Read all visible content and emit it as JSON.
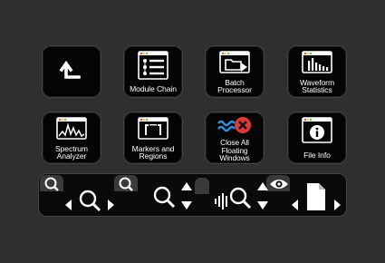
{
  "tiles": [
    {
      "id": "up",
      "label": "",
      "icon": "return-up-arrow-icon"
    },
    {
      "id": "module-chain",
      "label": "Module Chain",
      "icon": "module-chain-list-icon"
    },
    {
      "id": "batch-processor",
      "label": "Batch\nProcessor",
      "icon": "batch-processor-folder-icon"
    },
    {
      "id": "waveform-statistics",
      "label": "Waveform\nStatistics",
      "icon": "waveform-statistics-icon"
    },
    {
      "id": "spectrum-analyzer",
      "label": "Spectrum\nAnalyzer",
      "icon": "spectrum-analyzer-icon"
    },
    {
      "id": "markers-regions",
      "label": "Markers and\nRegions",
      "icon": "markers-regions-icon"
    },
    {
      "id": "close-floating",
      "label": "Close All\nFloating\nWindows",
      "icon": "close-floating-windows-icon"
    },
    {
      "id": "file-info",
      "label": "File Info",
      "icon": "info-icon"
    }
  ],
  "colors": {
    "background": "#2f2f2f",
    "tile": "#050505",
    "accent_blue": "#2f8fd8",
    "close_red": "#e0383a",
    "window_red": "#e04040",
    "window_yellow": "#e8c040",
    "window_green": "#50c050"
  },
  "toolbar": {
    "groups": [
      {
        "id": "horizontal-zoom",
        "icons": [
          "magnifier-icon",
          "left-arrow-icon",
          "zoom-icon",
          "right-arrow-icon"
        ]
      },
      {
        "id": "vertical-zoom",
        "icons": [
          "magnifier-icon",
          "zoom-icon",
          "up-arrow-icon",
          "down-arrow-icon"
        ]
      },
      {
        "id": "level-zoom",
        "icons": [
          "waveform-zoom-icon",
          "up-arrow-icon",
          "down-arrow-icon"
        ]
      },
      {
        "id": "file-navigation",
        "icons": [
          "eye-icon",
          "left-arrow-icon",
          "document-icon",
          "right-arrow-icon"
        ]
      }
    ]
  }
}
